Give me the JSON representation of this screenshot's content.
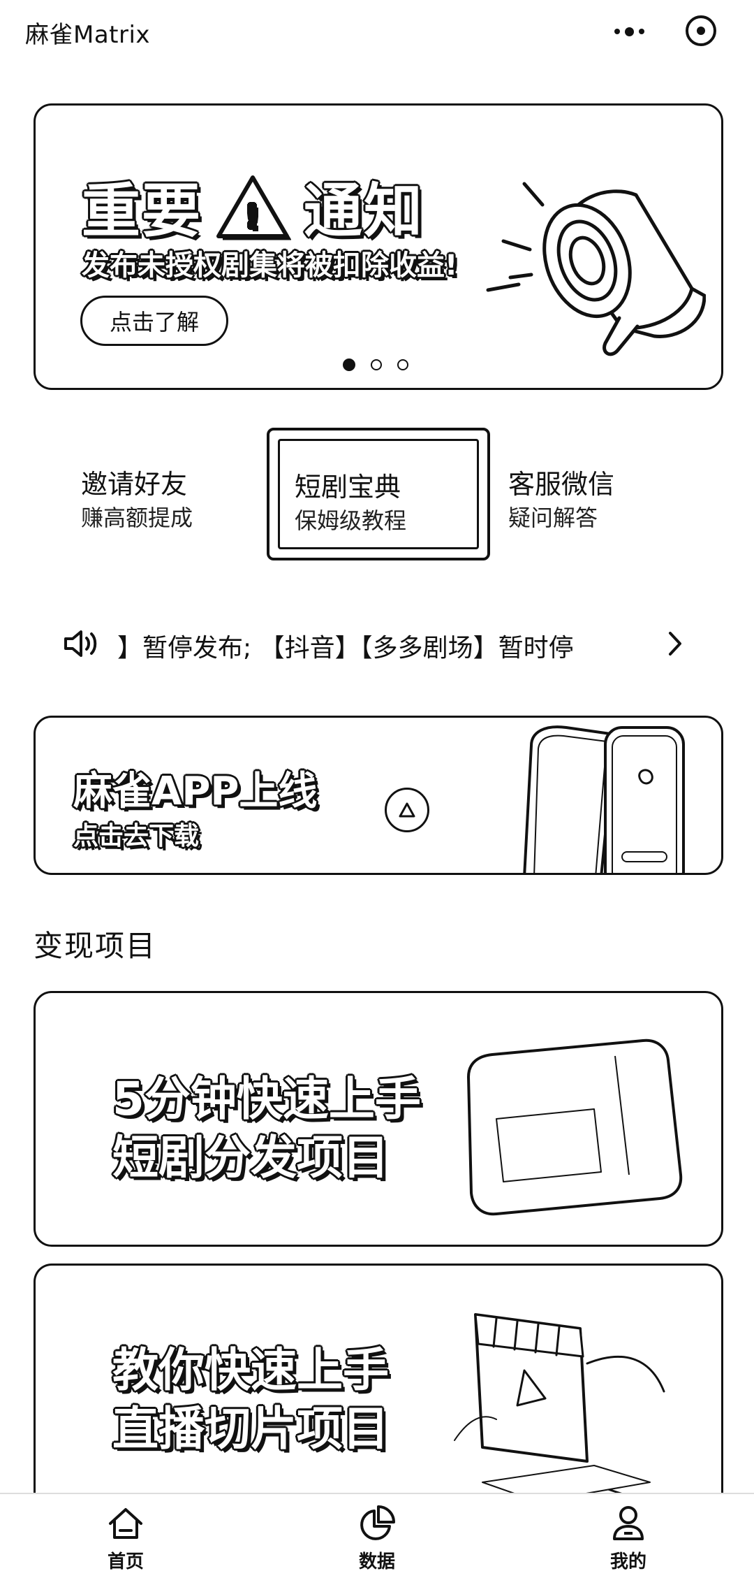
{
  "app": {
    "title": "麻雀Matrix"
  },
  "banner": {
    "title_left": "重要",
    "title_right": "通知",
    "warning_mark": "!",
    "subtitle": "发布未授权剧集将被扣除收益!",
    "button_label": "点击了解",
    "page_count": 3,
    "active_page": 1
  },
  "shortcuts": [
    {
      "title": "邀请好友",
      "subtitle": "赚高额提成"
    },
    {
      "title": "短剧宝典",
      "subtitle": "保姆级教程"
    },
    {
      "title": "客服微信",
      "subtitle": "疑问解答"
    }
  ],
  "announcement": {
    "text": "​】暂停发布; 【抖音】【多多剧场】暂时停"
  },
  "app_promo": {
    "title": "麻雀APP上线",
    "subtitle": "点击去下载"
  },
  "section": {
    "title": "变现项目"
  },
  "projects": [
    {
      "line1": "5分钟快速上手",
      "line2": "短剧分发项目"
    },
    {
      "line1": "教你快速上手",
      "line2": "直播切片项目"
    }
  ],
  "tabs": [
    {
      "label": "首页",
      "icon": "home-icon"
    },
    {
      "label": "数据",
      "icon": "pie-chart-icon"
    },
    {
      "label": "我的",
      "icon": "user-icon"
    }
  ],
  "colors": {
    "ink": "#111111",
    "background": "#ffffff"
  }
}
